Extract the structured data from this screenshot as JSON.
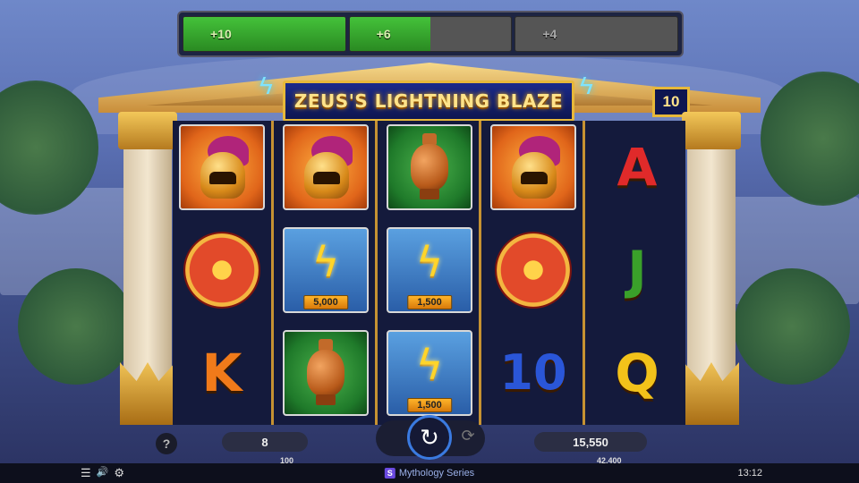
{
  "game": {
    "title": "ZEUS'S LIGHTNING BLAZE",
    "lines": "10",
    "series": "Mythology Series",
    "brand_logo": "S"
  },
  "bonus_meter": [
    {
      "label": "+10",
      "fill": 1.0
    },
    {
      "label": "+6",
      "fill": 0.5
    },
    {
      "label": "+4",
      "fill": 0.0
    }
  ],
  "reels": [
    [
      {
        "symbol": "helmet-icon"
      },
      {
        "symbol": "shield-icon"
      },
      {
        "symbol": "letter",
        "text": "K"
      }
    ],
    [
      {
        "symbol": "helmet-icon"
      },
      {
        "symbol": "bolt-icon",
        "prize": "5,000"
      },
      {
        "symbol": "vase-icon"
      }
    ],
    [
      {
        "symbol": "vase-icon"
      },
      {
        "symbol": "bolt-icon",
        "prize": "1,500"
      },
      {
        "symbol": "bolt-icon",
        "prize": "1,500"
      }
    ],
    [
      {
        "symbol": "helmet-icon"
      },
      {
        "symbol": "shield-icon"
      },
      {
        "symbol": "letter",
        "text": "10"
      }
    ],
    [
      {
        "symbol": "letter",
        "text": "A"
      },
      {
        "symbol": "letter",
        "text": "J"
      },
      {
        "symbol": "letter",
        "text": "Q"
      }
    ]
  ],
  "controls": {
    "help_label": "?",
    "bet_value": "8",
    "bet_sublabel": "100",
    "balance_value": "15,550",
    "balance_sublabel": "42,400",
    "spin_icon": "↻",
    "autoplay_icon": "⟳"
  },
  "status": {
    "menu_icon": "☰",
    "sound_icon": "🔊",
    "settings_icon": "⚙",
    "time": "13:12"
  },
  "colors": {
    "accent_gold": "#e7b83a",
    "meter_green": "#44c23a",
    "spin_ring": "#3a7ae0"
  }
}
